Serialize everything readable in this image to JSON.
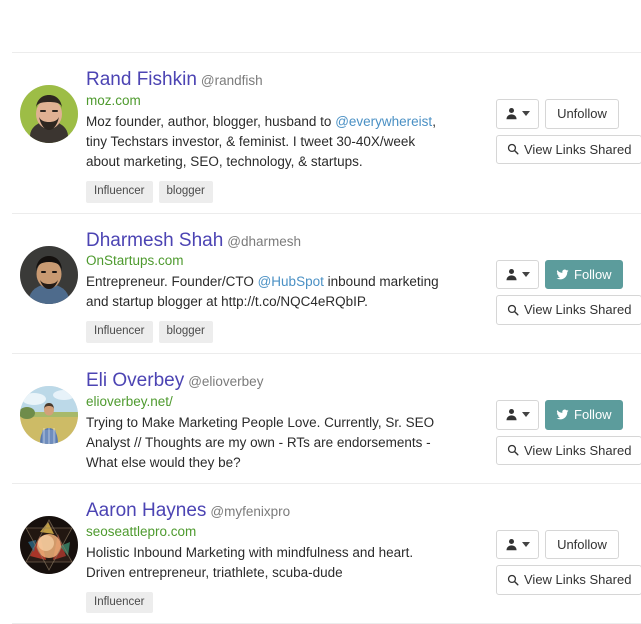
{
  "colors": {
    "name_link": "#4c44b3",
    "handle": "#7b7b7b",
    "site_link": "#4e9a2e",
    "mention_link": "#4a90c4",
    "follow_button_bg": "#5c9c9c",
    "tag_bg": "#ededed",
    "divider": "#ececec",
    "page_bg": "#ffffff"
  },
  "buttons": {
    "user_menu_label": "",
    "follow_label": "Follow",
    "unfollow_label": "Unfollow",
    "view_links_label": "View Links Shared"
  },
  "icons": {
    "user": "user-icon",
    "caret": "chevron-down-icon",
    "twitter": "twitter-bird-icon",
    "search": "search-icon"
  },
  "profiles": [
    {
      "name": "Rand Fishkin",
      "handle": "@randfish",
      "site": "moz.com",
      "bio_parts": [
        {
          "type": "text",
          "text": "Moz founder, author, blogger, husband to "
        },
        {
          "type": "mention",
          "text": "@everywhereist"
        },
        {
          "type": "text",
          "text": ", tiny Techstars investor, & feminist. I tweet 30-40X/week about marketing, SEO, technology, & startups."
        }
      ],
      "tags": [
        "Influencer",
        "blogger"
      ],
      "follow_state": "Unfollow",
      "avatar": "rand-fishkin-avatar"
    },
    {
      "name": "Dharmesh Shah",
      "handle": "@dharmesh",
      "site": "OnStartups.com",
      "bio_parts": [
        {
          "type": "text",
          "text": "Entrepreneur. Founder/CTO "
        },
        {
          "type": "mention",
          "text": "@HubSpot"
        },
        {
          "type": "text",
          "text": " inbound marketing and startup blogger at http://t.co/NQC4eRQbIP."
        }
      ],
      "tags": [
        "Influencer",
        "blogger"
      ],
      "follow_state": "Follow",
      "avatar": "dharmesh-shah-avatar"
    },
    {
      "name": "Eli Overbey",
      "handle": "@elioverbey",
      "site": "elioverbey.net/",
      "bio_parts": [
        {
          "type": "text",
          "text": "Trying to Make Marketing People Love. Currently, Sr. SEO Analyst // Thoughts are my own - RTs are endorsements - What else would they be?"
        }
      ],
      "tags": [],
      "follow_state": "Follow",
      "avatar": "eli-overbey-avatar"
    },
    {
      "name": "Aaron Haynes",
      "handle": "@myfenixpro",
      "site": "seoseattlepro.com",
      "bio_parts": [
        {
          "type": "text",
          "text": "Holistic Inbound Marketing with mindfulness and heart. Driven entrepreneur, triathlete, scuba-dude"
        }
      ],
      "tags": [
        "Influencer"
      ],
      "follow_state": "Unfollow",
      "avatar": "aaron-haynes-avatar"
    }
  ]
}
